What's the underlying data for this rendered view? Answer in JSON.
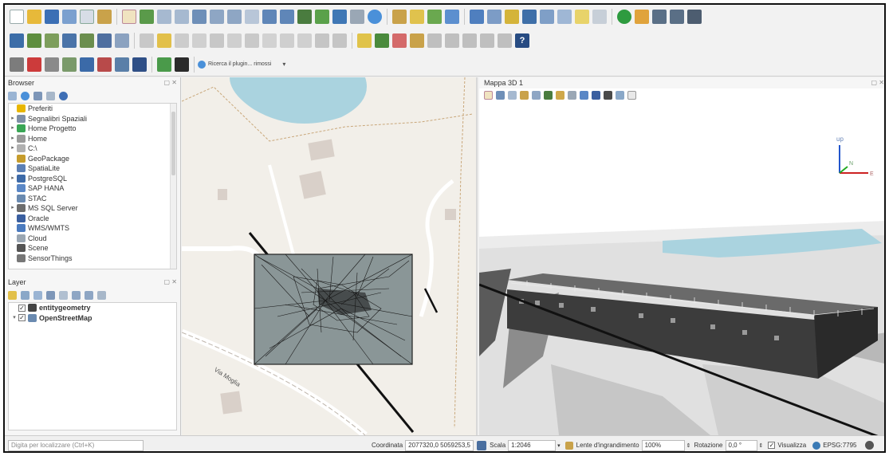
{
  "toolbars": {
    "plugin_search_label": "Ricerca il plugin... rimossi",
    "plugin_dropdown_arrow": "▾",
    "help_label": "?"
  },
  "browser": {
    "title": "Browser",
    "items": [
      {
        "label": "Preferiti",
        "icon": "star-icon",
        "color": "#e8b600",
        "expandable": false
      },
      {
        "label": "Segnalibri Spaziali",
        "icon": "spatial-bookmark-icon",
        "color": "#7f8fa6",
        "expandable": true
      },
      {
        "label": "Home Progetto",
        "icon": "project-home-icon",
        "color": "#3aa655",
        "expandable": true
      },
      {
        "label": "Home",
        "icon": "home-icon",
        "color": "#9a9a9a",
        "expandable": true
      },
      {
        "label": "C:\\",
        "icon": "drive-icon",
        "color": "#b0b0b0",
        "expandable": true
      },
      {
        "label": "GeoPackage",
        "icon": "geopackage-icon",
        "color": "#c69c2c",
        "expandable": false
      },
      {
        "label": "SpatiaLite",
        "icon": "spatialite-icon",
        "color": "#5b7fb5",
        "expandable": false
      },
      {
        "label": "PostgreSQL",
        "icon": "postgresql-icon",
        "color": "#3d6aa8",
        "expandable": true
      },
      {
        "label": "SAP HANA",
        "icon": "sap-hana-icon",
        "color": "#5a87c6",
        "expandable": false
      },
      {
        "label": "STAC",
        "icon": "stac-icon",
        "color": "#6a8ab0",
        "expandable": false
      },
      {
        "label": "MS SQL Server",
        "icon": "mssql-icon",
        "color": "#6d6d6d",
        "expandable": true
      },
      {
        "label": "Oracle",
        "icon": "oracle-icon",
        "color": "#3a5fa0",
        "expandable": false
      },
      {
        "label": "WMS/WMTS",
        "icon": "wms-icon",
        "color": "#4b7bbf",
        "expandable": false
      },
      {
        "label": "Cloud",
        "icon": "cloud-icon",
        "color": "#9aa6b2",
        "expandable": false
      },
      {
        "label": "Scene",
        "icon": "scene-icon",
        "color": "#555555",
        "expandable": false
      },
      {
        "label": "SensorThings",
        "icon": "sensorthings-icon",
        "color": "#777777",
        "expandable": false
      }
    ]
  },
  "layers": {
    "title": "Layer",
    "items": [
      {
        "label": "entitygeometry",
        "checked": "✓",
        "icon_color": "#444444",
        "expandable": false
      },
      {
        "label": "OpenStreetMap",
        "checked": "✓",
        "icon_color": "#6a8ab0",
        "expandable": true
      }
    ]
  },
  "map2d": {
    "street_label": "Via Moglia"
  },
  "view3d": {
    "title": "Mappa 3D 1",
    "axis_up": "up",
    "axis_north": "N",
    "axis_east": "E"
  },
  "statusbar": {
    "locator_placeholder": "Digita per localizzare (Ctrl+K)",
    "coordinate_label": "Coordinata",
    "coordinate_value": "2077320,0 5059253,5",
    "scale_label": "Scala",
    "scale_value": "1:2046",
    "magnifier_label": "Lente d'ingrandimento",
    "magnifier_value": "100%",
    "rotation_label": "Rotazione",
    "rotation_value": "0,0 °",
    "render_check": "✓",
    "render_label": "Visualizza",
    "crs_label": "EPSG:7795"
  },
  "colors": {
    "map_background": "#f2efe9",
    "water": "#aad3df",
    "building_2d": "#d9d0c9",
    "mesh_fill": "#8a9697",
    "sky_3d": "#ffffff",
    "building_3d": "#3a3a3a"
  }
}
